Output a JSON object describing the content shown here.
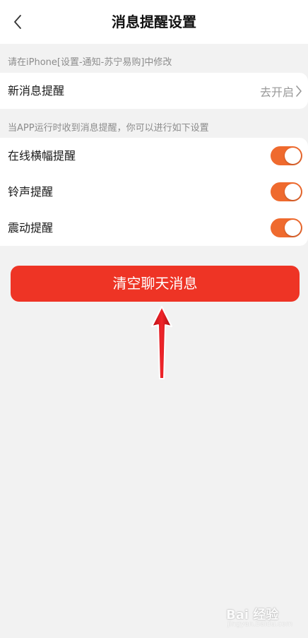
{
  "header": {
    "title": "消息提醒设置",
    "back_icon": "chevron-left-icon"
  },
  "system_hint": "请在iPhone[设置-通知-苏宁易购]中修改",
  "new_message": {
    "label": "新消息提醒",
    "action_label": "去开启",
    "action_icon": "chevron-right-icon"
  },
  "app_hint": "当APP运行时收到消息提醒，你可以进行如下设置",
  "settings": [
    {
      "label": "在线横幅提醒",
      "enabled": true
    },
    {
      "label": "铃声提醒",
      "enabled": true
    },
    {
      "label": "震动提醒",
      "enabled": true
    }
  ],
  "clear_button": {
    "label": "清空聊天消息"
  },
  "annotation": {
    "icon": "red-arrow-up-icon"
  },
  "watermark": {
    "brand": "Bai 经验",
    "sub": "jingyan.baidu.com"
  },
  "colors": {
    "accent": "#ee3425",
    "toggle_on": "#ef6a2e",
    "background": "#f2f2f2",
    "hint_text": "#8c8c8c"
  }
}
